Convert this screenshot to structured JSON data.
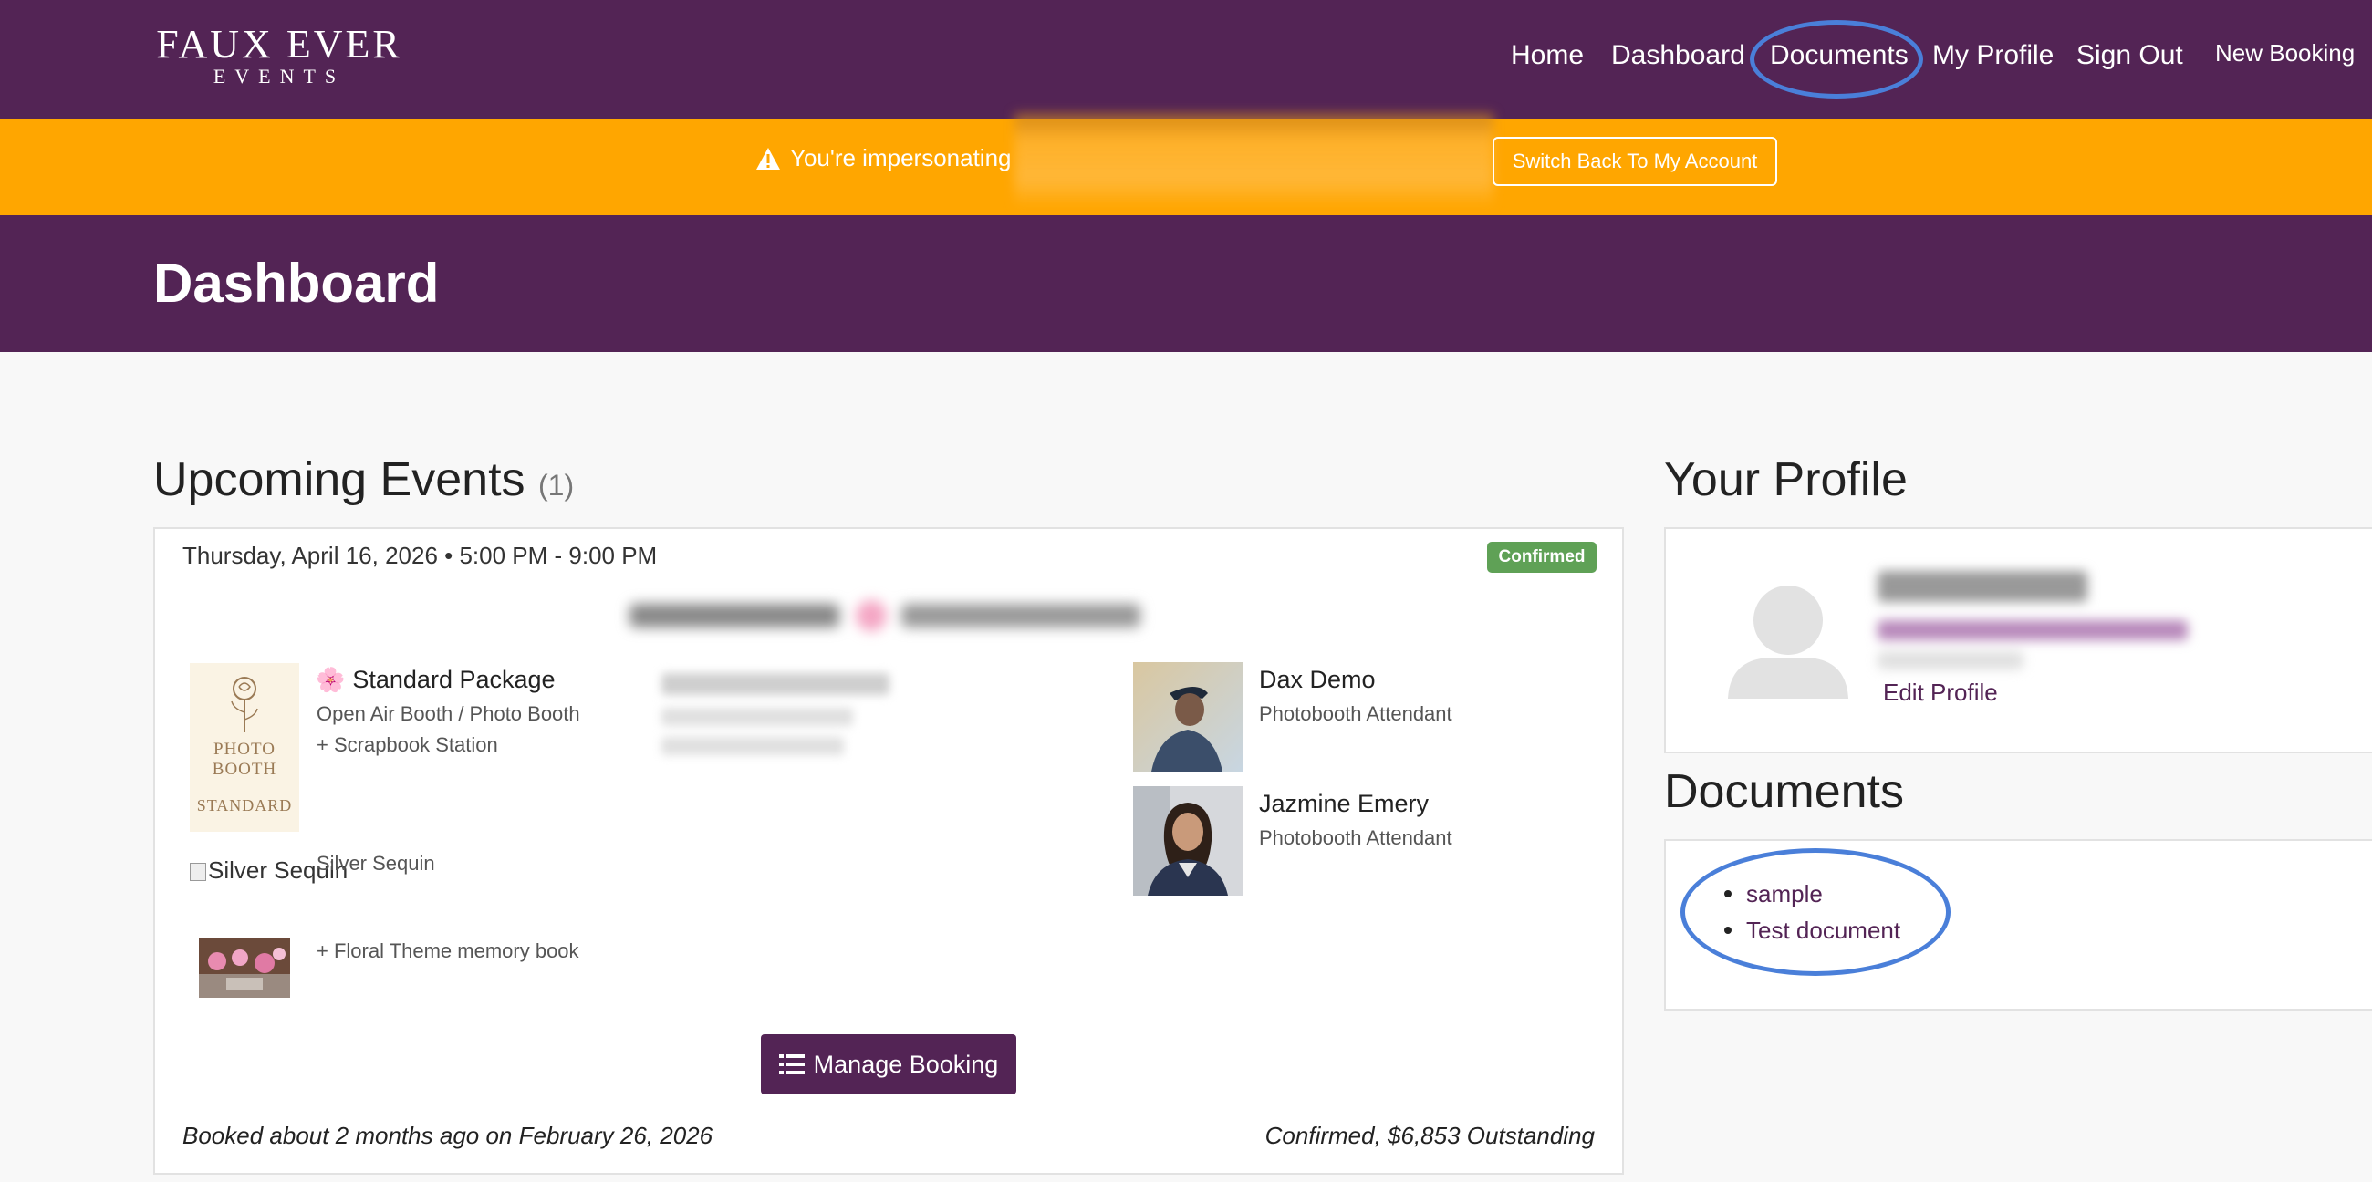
{
  "header": {
    "logo_line1": "FAUX EVER",
    "logo_line2": "EVENTS",
    "nav": [
      "Home",
      "Dashboard",
      "Documents",
      "My Profile",
      "Sign Out",
      "New Booking"
    ]
  },
  "impersonation": {
    "text": "You're impersonating",
    "switch_label": "Switch Back To My Account",
    "icon": "warning-icon"
  },
  "page": {
    "title": "Dashboard"
  },
  "events": {
    "title": "Upcoming Events",
    "count": "(1)",
    "date": "Thursday, April 16, 2026 • 5:00 PM - 9:00 PM",
    "status": "Confirmed",
    "package_name": "Standard Package",
    "package_icon": "flower-icon",
    "package_line1": "Open Air Booth / Photo Booth",
    "package_line2": "+ Scrapbook Station",
    "package_image_line1": "PHOTO",
    "package_image_line2": "BOOTH",
    "package_image_line3": "STANDARD",
    "addon_broken_alt": "Silver Sequin",
    "addon_label": "Silver Sequin",
    "book_label": "+ Floral Theme memory book",
    "staff": [
      {
        "name": "Dax Demo",
        "role": "Photobooth Attendant"
      },
      {
        "name": "Jazmine Emery",
        "role": "Photobooth Attendant"
      }
    ],
    "manage_label": "Manage Booking",
    "booked_text": "Booked about 2 months ago on February 26, 2026",
    "balance_text": "Confirmed, $6,853 Outstanding"
  },
  "profile": {
    "title": "Your Profile",
    "edit_label": "Edit Profile"
  },
  "documents": {
    "title": "Documents",
    "items": [
      "sample",
      "Test document"
    ]
  },
  "colors": {
    "brand_purple": "#532455",
    "warning_orange": "#ffa600",
    "confirmed_green": "#5fa156",
    "annotation_blue": "#4a7fd9"
  }
}
